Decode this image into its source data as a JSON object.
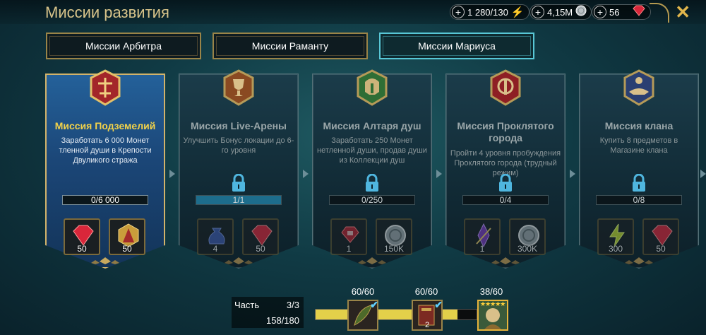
{
  "header": {
    "title": "Миссии развития",
    "resources": [
      {
        "value": "1 280/130",
        "icon": "energy-bolt-icon"
      },
      {
        "value": "4,15M",
        "icon": "silver-coin-icon"
      },
      {
        "value": "56",
        "icon": "ruby-gem-icon"
      }
    ],
    "close": "✕"
  },
  "tabs": [
    {
      "label": "Миссии Арбитра",
      "active": false
    },
    {
      "label": "Миссии Раманту",
      "active": false
    },
    {
      "label": "Миссии Мариуса",
      "active": true
    }
  ],
  "missions": [
    {
      "title": "Миссия Подземелий",
      "desc": "Заработать 6 000 Монет тленной души в Крепости Двуликого стража",
      "progress": "0/6 000",
      "progress_fraction": 0,
      "locked": false,
      "rewards": [
        {
          "icon": "ruby-gem-icon",
          "value": "50"
        },
        {
          "icon": "dungeon-token-icon",
          "value": "50"
        }
      ]
    },
    {
      "title": "Миссия Live-Арены",
      "desc": "Улучшить Бонус локации до 6-го уровня",
      "progress": "1/1",
      "progress_fraction": 1,
      "locked": true,
      "rewards": [
        {
          "icon": "loot-bag-icon",
          "value": "4"
        },
        {
          "icon": "ruby-gem-icon",
          "value": "50"
        }
      ]
    },
    {
      "title": "Миссия Алтаря душ",
      "desc": "Заработать 250 Монет нетленной души, продав души из Коллекции душ",
      "progress": "0/250",
      "progress_fraction": 0,
      "locked": true,
      "rewards": [
        {
          "icon": "ruby-chest-icon",
          "value": "1"
        },
        {
          "icon": "silver-coin-icon",
          "value": "150K"
        }
      ]
    },
    {
      "title": "Миссия Проклятого города",
      "desc": "Пройти 4 уровня пробуждения Проклятого города (трудный режим)",
      "progress": "0/4",
      "progress_fraction": 0,
      "locked": true,
      "rewards": [
        {
          "icon": "purple-shard-icon",
          "value": "1"
        },
        {
          "icon": "silver-coin-icon",
          "value": "300K"
        }
      ]
    },
    {
      "title": "Миссия клана",
      "desc": "Купить 8 предметов в Магазине клана",
      "progress": "0/8",
      "progress_fraction": 0,
      "locked": true,
      "rewards": [
        {
          "icon": "energy-bolt-icon",
          "value": "300"
        },
        {
          "icon": "ruby-gem-icon",
          "value": "50"
        }
      ]
    }
  ],
  "bottom": {
    "part_label": "Часть",
    "part_value": "3/3",
    "count": "158/180",
    "progress_fraction": 0.88,
    "stages": [
      {
        "label": "60/60",
        "completed": true,
        "sub": ""
      },
      {
        "label": "60/60",
        "completed": true,
        "sub": "2"
      },
      {
        "label": "38/60",
        "completed": false,
        "sub": ""
      }
    ]
  },
  "colors": {
    "accent_gold": "#d2b36a",
    "active_tab": "#58c7d6",
    "active_card": "#24619a",
    "title_yellow": "#f2d24a"
  }
}
